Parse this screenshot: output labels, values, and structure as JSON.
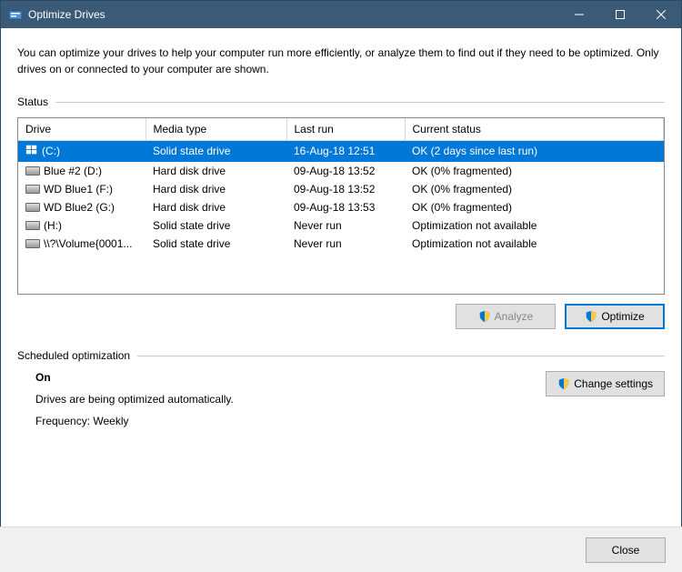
{
  "window": {
    "title": "Optimize Drives"
  },
  "description": "You can optimize your drives to help your computer run more efficiently, or analyze them to find out if they need to be optimized. Only drives on or connected to your computer are shown.",
  "status_label": "Status",
  "columns": {
    "drive": "Drive",
    "media": "Media type",
    "last": "Last run",
    "current": "Current status"
  },
  "rows": [
    {
      "drive": "(C:)",
      "media": "Solid state drive",
      "last": "16-Aug-18 12:51",
      "status": "OK (2 days since last run)",
      "selected": true,
      "icon": "win"
    },
    {
      "drive": "Blue #2 (D:)",
      "media": "Hard disk drive",
      "last": "09-Aug-18 13:52",
      "status": "OK (0% fragmented)",
      "selected": false,
      "icon": "hdd"
    },
    {
      "drive": "WD Blue1 (F:)",
      "media": "Hard disk drive",
      "last": "09-Aug-18 13:52",
      "status": "OK (0% fragmented)",
      "selected": false,
      "icon": "hdd"
    },
    {
      "drive": "WD Blue2 (G:)",
      "media": "Hard disk drive",
      "last": "09-Aug-18 13:53",
      "status": "OK (0% fragmented)",
      "selected": false,
      "icon": "hdd"
    },
    {
      "drive": "(H:)",
      "media": "Solid state drive",
      "last": "Never run",
      "status": "Optimization not available",
      "selected": false,
      "icon": "hdd"
    },
    {
      "drive": "\\\\?\\Volume{0001...",
      "media": "Solid state drive",
      "last": "Never run",
      "status": "Optimization not available",
      "selected": false,
      "icon": "hdd"
    }
  ],
  "buttons": {
    "analyze": "Analyze",
    "optimize": "Optimize",
    "change_settings": "Change settings",
    "close": "Close"
  },
  "schedule": {
    "label": "Scheduled optimization",
    "state": "On",
    "auto_text": "Drives are being optimized automatically.",
    "frequency": "Frequency: Weekly"
  }
}
